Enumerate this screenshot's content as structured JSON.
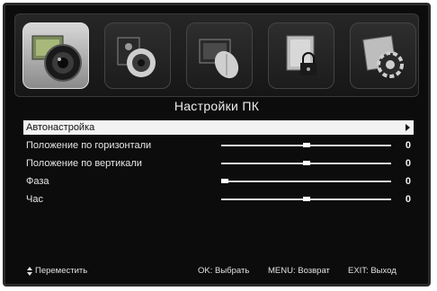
{
  "menu": {
    "title": "Настройки ПК",
    "tabs": [
      {
        "icon": "picture-icon",
        "selected": true
      },
      {
        "icon": "sound-icon",
        "selected": false
      },
      {
        "icon": "setup-icon",
        "selected": false
      },
      {
        "icon": "lock-icon",
        "selected": false
      },
      {
        "icon": "settings-gear-icon",
        "selected": false
      }
    ],
    "items": [
      {
        "label": "Автонастройка",
        "type": "submenu"
      },
      {
        "label": "Положение по горизонтали",
        "type": "slider",
        "value": "0",
        "level": 0.5
      },
      {
        "label": "Положение по вертикали",
        "type": "slider",
        "value": "0",
        "level": 0.5
      },
      {
        "label": "Фаза",
        "type": "slider",
        "value": "0",
        "level": 0.0
      },
      {
        "label": "Час",
        "type": "slider",
        "value": "0",
        "level": 0.5
      }
    ]
  },
  "footer": {
    "move": "Переместить",
    "ok": "OK: Выбрать",
    "menu": "MENU: Возврат",
    "exit": "EXIT: Выход"
  },
  "colors": {
    "screen_bg": "#0c0c0c",
    "highlight": "#f2f2f2",
    "text": "#e6e6e6"
  }
}
